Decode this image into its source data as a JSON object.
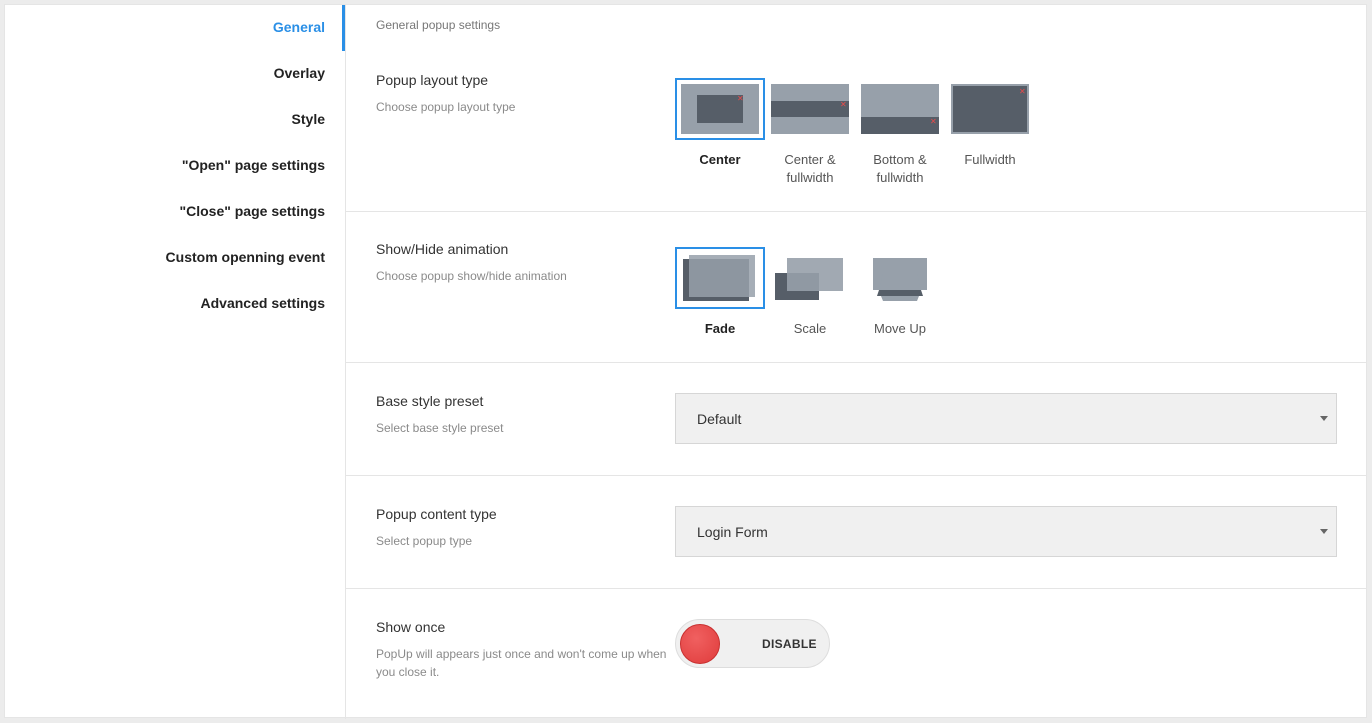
{
  "sidebar": {
    "items": [
      {
        "label": "General",
        "active": true
      },
      {
        "label": "Overlay"
      },
      {
        "label": "Style"
      },
      {
        "label": "\"Open\" page settings"
      },
      {
        "label": "\"Close\" page settings"
      },
      {
        "label": "Custom openning event"
      },
      {
        "label": "Advanced settings"
      }
    ]
  },
  "main": {
    "subtitle": "General popup settings",
    "layout": {
      "title": "Popup layout type",
      "desc": "Choose popup layout type",
      "options": [
        {
          "label": "Center",
          "selected": true,
          "icon": "layout-center-icon"
        },
        {
          "label": "Center & fullwidth",
          "icon": "layout-center-fullwidth-icon"
        },
        {
          "label": "Bottom & fullwidth",
          "icon": "layout-bottom-fullwidth-icon"
        },
        {
          "label": "Fullwidth",
          "icon": "layout-fullwidth-icon"
        }
      ]
    },
    "animation": {
      "title": "Show/Hide animation",
      "desc": "Choose popup show/hide animation",
      "options": [
        {
          "label": "Fade",
          "selected": true,
          "icon": "animation-fade-icon"
        },
        {
          "label": "Scale",
          "icon": "animation-scale-icon"
        },
        {
          "label": "Move Up",
          "icon": "animation-move-up-icon"
        }
      ]
    },
    "style_preset": {
      "title": "Base style preset",
      "desc": "Select base style preset",
      "value": "Default"
    },
    "content_type": {
      "title": "Popup content type",
      "desc": "Select popup type",
      "value": "Login Form"
    },
    "show_once": {
      "title": "Show once",
      "desc": "PopUp will appears just once and won't come up when you close it.",
      "toggle_label": "DISABLE",
      "enabled": false
    }
  },
  "colors": {
    "accent": "#2a8fe6",
    "thumb_light": "#97a0aa",
    "thumb_dark": "#565e68",
    "close_red": "#e84a4a",
    "toggle_red": "#e03c3c"
  }
}
